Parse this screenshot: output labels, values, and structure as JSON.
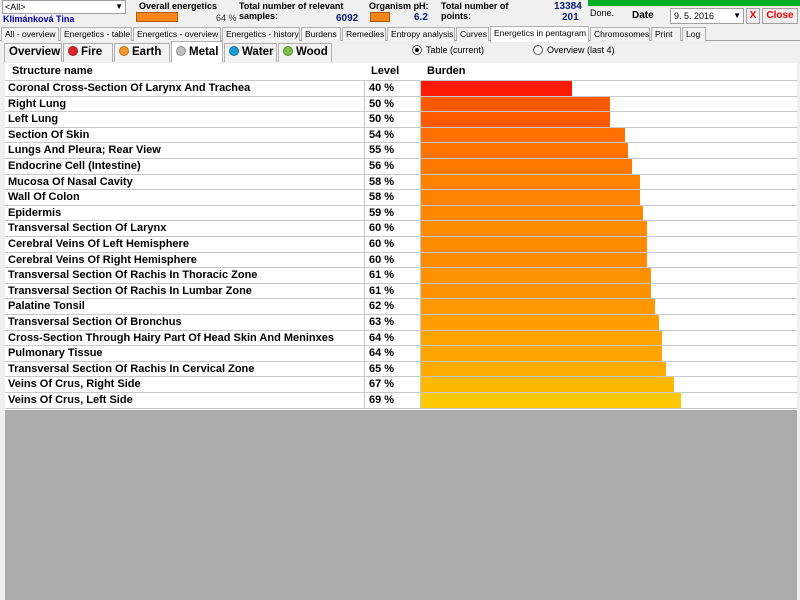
{
  "filter": {
    "selected": "<All>"
  },
  "patient": {
    "name": "Klimánková Tina"
  },
  "overall": {
    "label": "Overall energetics",
    "percent_text": "64 %",
    "bar_color": "#f7861c"
  },
  "samples": {
    "label": "Total number of relevant samples:",
    "value": "6092"
  },
  "ph": {
    "label": "Organism pH:",
    "value": "6.2"
  },
  "points": {
    "label": "Total number of points:",
    "value1": "13384",
    "value2": "201"
  },
  "status": {
    "text": "Done.",
    "progress": 1.0,
    "progress_color": "#06b025"
  },
  "date": {
    "label": "Date",
    "value": "9. 5. 2016"
  },
  "buttons": {
    "x_label": "X",
    "close_label": "Close"
  },
  "main_tabs": [
    {
      "label": "All - overview"
    },
    {
      "label": "Energetics - table"
    },
    {
      "label": "Energetics - overview"
    },
    {
      "label": "Energetics - history"
    },
    {
      "label": "Burdens"
    },
    {
      "label": "Remedies"
    },
    {
      "label": "Entropy analysis"
    },
    {
      "label": "Curves"
    },
    {
      "label": "Energetics in pentagram",
      "active": true
    },
    {
      "label": "Chromosomes"
    },
    {
      "label": "Print"
    },
    {
      "label": "Log"
    }
  ],
  "element_tabs": [
    {
      "label": "Overview",
      "color": null
    },
    {
      "label": "Fire",
      "color": "#d9262b"
    },
    {
      "label": "Earth",
      "color": "#f39a2d"
    },
    {
      "label": "Metal",
      "color": "#bfbfbf",
      "active": true
    },
    {
      "label": "Water",
      "color": "#1c9ad6"
    },
    {
      "label": "Wood",
      "color": "#7cc043"
    }
  ],
  "view_options": {
    "table_label": "Table (current)",
    "overview_label": "Overview (last 4)",
    "selected": "table"
  },
  "table": {
    "columns": {
      "name": "Structure name",
      "level": "Level",
      "burden": "Burden"
    },
    "rows": [
      {
        "name": "Coronal Cross-Section Of Larynx And Trachea",
        "level": "40 %",
        "burden": 40,
        "color": "#ff1a08"
      },
      {
        "name": "Right Lung",
        "level": "50 %",
        "burden": 50,
        "color": "#ff5a00"
      },
      {
        "name": "Left Lung",
        "level": "50 %",
        "burden": 50,
        "color": "#ff5a00"
      },
      {
        "name": "Section Of Skin",
        "level": "54 %",
        "burden": 54,
        "color": "#ff6e00"
      },
      {
        "name": "Lungs And Pleura; Rear View",
        "level": "55 %",
        "burden": 55,
        "color": "#ff7400"
      },
      {
        "name": "Endocrine Cell (Intestine)",
        "level": "56 %",
        "burden": 56,
        "color": "#ff7800"
      },
      {
        "name": "Mucosa Of Nasal Cavity",
        "level": "58 %",
        "burden": 58,
        "color": "#ff8200"
      },
      {
        "name": "Wall Of Colon",
        "level": "58 %",
        "burden": 58,
        "color": "#ff8200"
      },
      {
        "name": "Epidermis",
        "level": "59 %",
        "burden": 59,
        "color": "#ff8800"
      },
      {
        "name": "Transversal Section Of Larynx",
        "level": "60 %",
        "burden": 60,
        "color": "#ff8c00"
      },
      {
        "name": "Cerebral Veins Of Left Hemisphere",
        "level": "60 %",
        "burden": 60,
        "color": "#ff8c00"
      },
      {
        "name": "Cerebral Veins Of Right Hemisphere",
        "level": "60 %",
        "burden": 60,
        "color": "#ff8c00"
      },
      {
        "name": "Transversal Section Of Rachis In Thoracic Zone",
        "level": "61 %",
        "burden": 61,
        "color": "#ff9200"
      },
      {
        "name": "Transversal Section Of Rachis In Lumbar Zone",
        "level": "61 %",
        "burden": 61,
        "color": "#ff9200"
      },
      {
        "name": "Palatine Tonsil",
        "level": "62 %",
        "burden": 62,
        "color": "#ff9800"
      },
      {
        "name": "Transversal Section Of Bronchus",
        "level": "63 %",
        "burden": 63,
        "color": "#ff9e00"
      },
      {
        "name": "Cross-Section Through Hairy Part Of Head Skin And Meninxes",
        "level": "64 %",
        "burden": 64,
        "color": "#ffa400"
      },
      {
        "name": "Pulmonary Tissue",
        "level": "64 %",
        "burden": 64,
        "color": "#ffa400"
      },
      {
        "name": "Transversal Section Of Rachis In Cervical Zone",
        "level": "65 %",
        "burden": 65,
        "color": "#ffaa00"
      },
      {
        "name": "Veins Of Crus, Right Side",
        "level": "67 %",
        "burden": 67,
        "color": "#ffb800"
      },
      {
        "name": "Veins Of Crus, Left Side",
        "level": "69 %",
        "burden": 69,
        "color": "#ffc800"
      }
    ]
  }
}
